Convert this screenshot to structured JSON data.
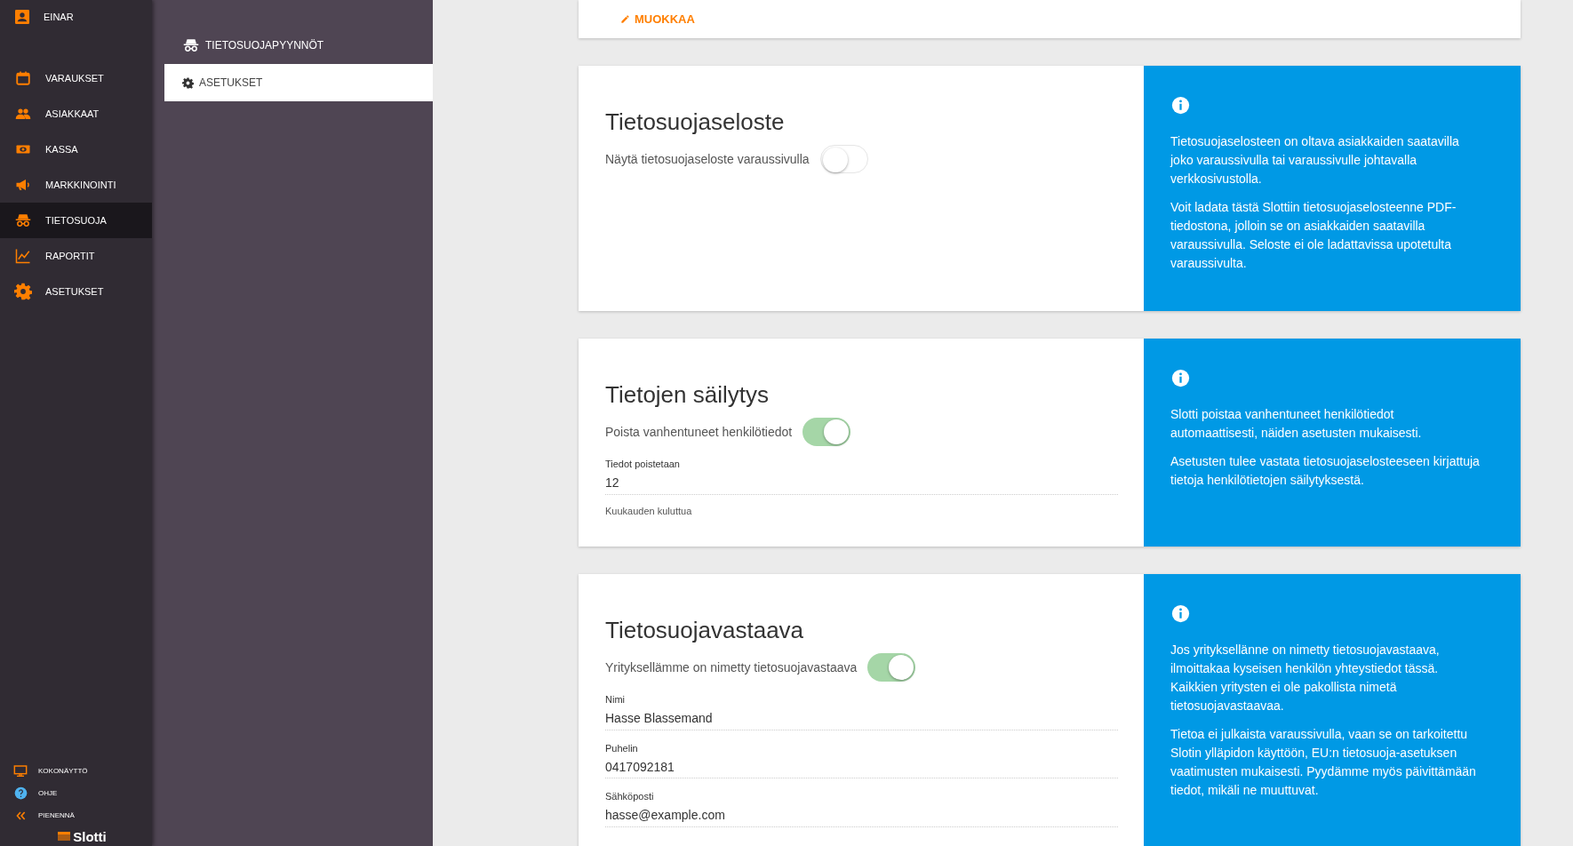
{
  "user": {
    "name": "EINAR"
  },
  "nav": [
    {
      "label": "VARAUKSET",
      "selected": false
    },
    {
      "label": "ASIAKKAAT",
      "selected": false
    },
    {
      "label": "KASSA",
      "selected": false
    },
    {
      "label": "MARKKINOINTI",
      "selected": false
    },
    {
      "label": "TIETOSUOJA",
      "selected": true
    },
    {
      "label": "RAPORTIT",
      "selected": false
    },
    {
      "label": "ASETUKSET",
      "selected": false
    }
  ],
  "footer_nav": [
    {
      "label": "KOKONÄYTTÖ"
    },
    {
      "label": "OHJE"
    },
    {
      "label": "PIENENNÄ"
    }
  ],
  "logo": "Slotti",
  "submenu": [
    {
      "label": "TIETOSUOJAPYYNNÖT",
      "selected": false
    },
    {
      "label": "ASETUKSET",
      "selected": true
    }
  ],
  "edit_button": "MUOKKAA",
  "sections": [
    {
      "title": "Tietosuojaseloste",
      "toggle": {
        "label": "Näytä tietosuojaseloste varaussivulla",
        "on": false
      },
      "info": [
        "Tietosuojaselosteen on oltava asiakkaiden saatavilla joko varaussivulla tai varaussivulle johtavalla verkkosivustolla.",
        "Voit ladata tästä Slottiin tietosuojaselosteenne PDF-tiedostona, jolloin se on asiakkaiden saatavilla varaussivulla. Seloste ei ole ladattavissa upotetulta varaussivulta."
      ]
    },
    {
      "title": "Tietojen säilytys",
      "toggle": {
        "label": "Poista vanhentuneet henkilötiedot",
        "on": true
      },
      "fields": [
        {
          "label": "Tiedot poistetaan",
          "value": "12",
          "hint": "Kuukauden kuluttua"
        }
      ],
      "info": [
        "Slotti poistaa vanhentuneet henkilötiedot automaattisesti, näiden asetusten mukaisesti.",
        "Asetusten tulee vastata tietosuojaselosteeseen kirjattuja tietoja henkilötietojen säilytyksestä."
      ]
    },
    {
      "title": "Tietosuojavastaava",
      "toggle": {
        "label": "Yrityksellämme on nimetty tietosuojavastaava",
        "on": true
      },
      "fields": [
        {
          "label": "Nimi",
          "value": "Hasse Blassemand"
        },
        {
          "label": "Puhelin",
          "value": "0417092181"
        },
        {
          "label": "Sähköposti",
          "value": "hasse@example.com"
        }
      ],
      "info": [
        "Jos yrityksellänne on nimetty tietosuojavastaava, ilmoittakaa kyseisen henkilön yhteystiedot tässä. Kaikkien yritysten ei ole pakollista nimetä tietosuojavastaavaa.",
        "Tietoa ei julkaista varaussivulla, vaan se on tarkoitettu Slotin ylläpidon käyttöön, EU:n tietosuoja-asetuksen vaatimusten mukaisesti. Pyydämme myös päivittämään tiedot, mikäli ne muuttuvat."
      ]
    }
  ]
}
